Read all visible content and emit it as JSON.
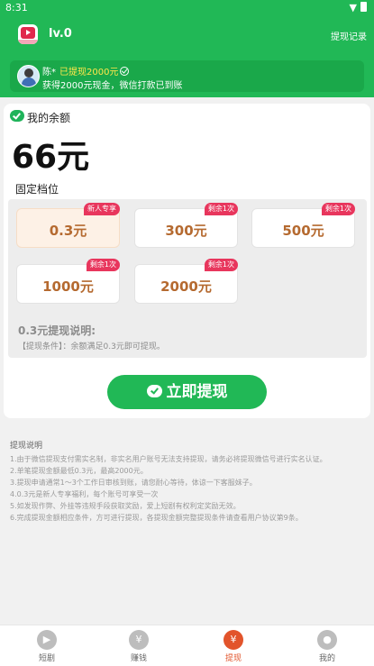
{
  "status_bar": {
    "time": "8:31"
  },
  "header": {
    "level": "lv.0",
    "record_link": "提现记录"
  },
  "notice": {
    "user": "陈*",
    "headline": "已提现2000元",
    "detail": "获得2000元现金，微信打款已到账"
  },
  "balance": {
    "title": "我的余额",
    "value": "66元"
  },
  "tiers": {
    "title": "固定档位",
    "items": [
      {
        "amount": "0.3元",
        "tag": "新人专享",
        "selected": true
      },
      {
        "amount": "300元",
        "tag": "剩余1次",
        "selected": false
      },
      {
        "amount": "500元",
        "tag": "剩余1次",
        "selected": false
      },
      {
        "amount": "1000元",
        "tag": "剩余1次",
        "selected": false
      },
      {
        "amount": "2000元",
        "tag": "剩余1次",
        "selected": false
      }
    ]
  },
  "explanation": {
    "title": "0.3元提现说明:",
    "text": "【提现条件】：余额满足0.3元即可提现。"
  },
  "withdraw_button": {
    "label": "立即提现"
  },
  "info": {
    "title": "提现说明",
    "items": [
      "1.由于微信提现支付需实名制，非实名用户账号无法支持提现，请务必将提现微信号进行实名认证。",
      "2.单笔提现金额最低0.3元，最高2000元。",
      "3.提现申请通常1～3个工作日审核到账，请您耐心等待，体谅一下客服妹子。",
      "4.0.3元是新人专享福利，每个账号可享受一次",
      "5.如发现作弊、外挂等违规手段获取奖励，爱上短剧有权利定奖励无效。",
      "6.完成提现金额相应条件，方可进行提现，各提现金额完整提现条件请查看用户协议第9条。"
    ]
  },
  "tabbar": {
    "items": [
      {
        "label": "短剧",
        "icon": "video-icon",
        "active": false
      },
      {
        "label": "赚钱",
        "icon": "money-bag-icon",
        "active": false
      },
      {
        "label": "提现",
        "icon": "withdraw-icon",
        "active": true
      },
      {
        "label": "我的",
        "icon": "user-icon",
        "active": false
      }
    ]
  },
  "colors": {
    "brand_green": "#21b856",
    "tag_red": "#e8365d",
    "amount_brown": "#b56a30",
    "tab_active": "#e2542b"
  }
}
